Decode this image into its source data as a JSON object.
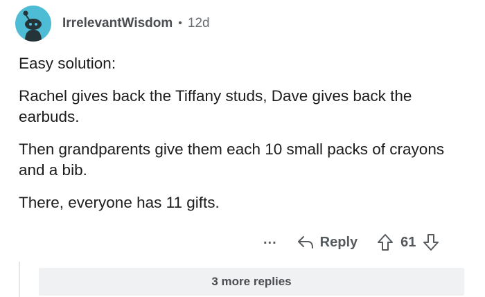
{
  "comment": {
    "author": "IrrelevantWisdom",
    "separator": "•",
    "age": "12d",
    "paragraphs": [
      "Easy solution:",
      "Rachel gives back the Tiffany studs, Dave gives back the earbuds.",
      "Then grandparents give them each 10 small packs of crayons and a bib.",
      "There, everyone has 11 gifts."
    ]
  },
  "actions": {
    "more_label": "...",
    "reply_label": "Reply",
    "upvote_icon": "arrow-up-icon",
    "score": "61",
    "downvote_icon": "arrow-down-icon"
  },
  "thread": {
    "more_replies_label": "3 more replies"
  },
  "colors": {
    "avatar_bg": "#4fbcd6",
    "text": "#1c1c1c",
    "meta": "#575a5e",
    "more_replies_bg": "#f0f1f2"
  }
}
